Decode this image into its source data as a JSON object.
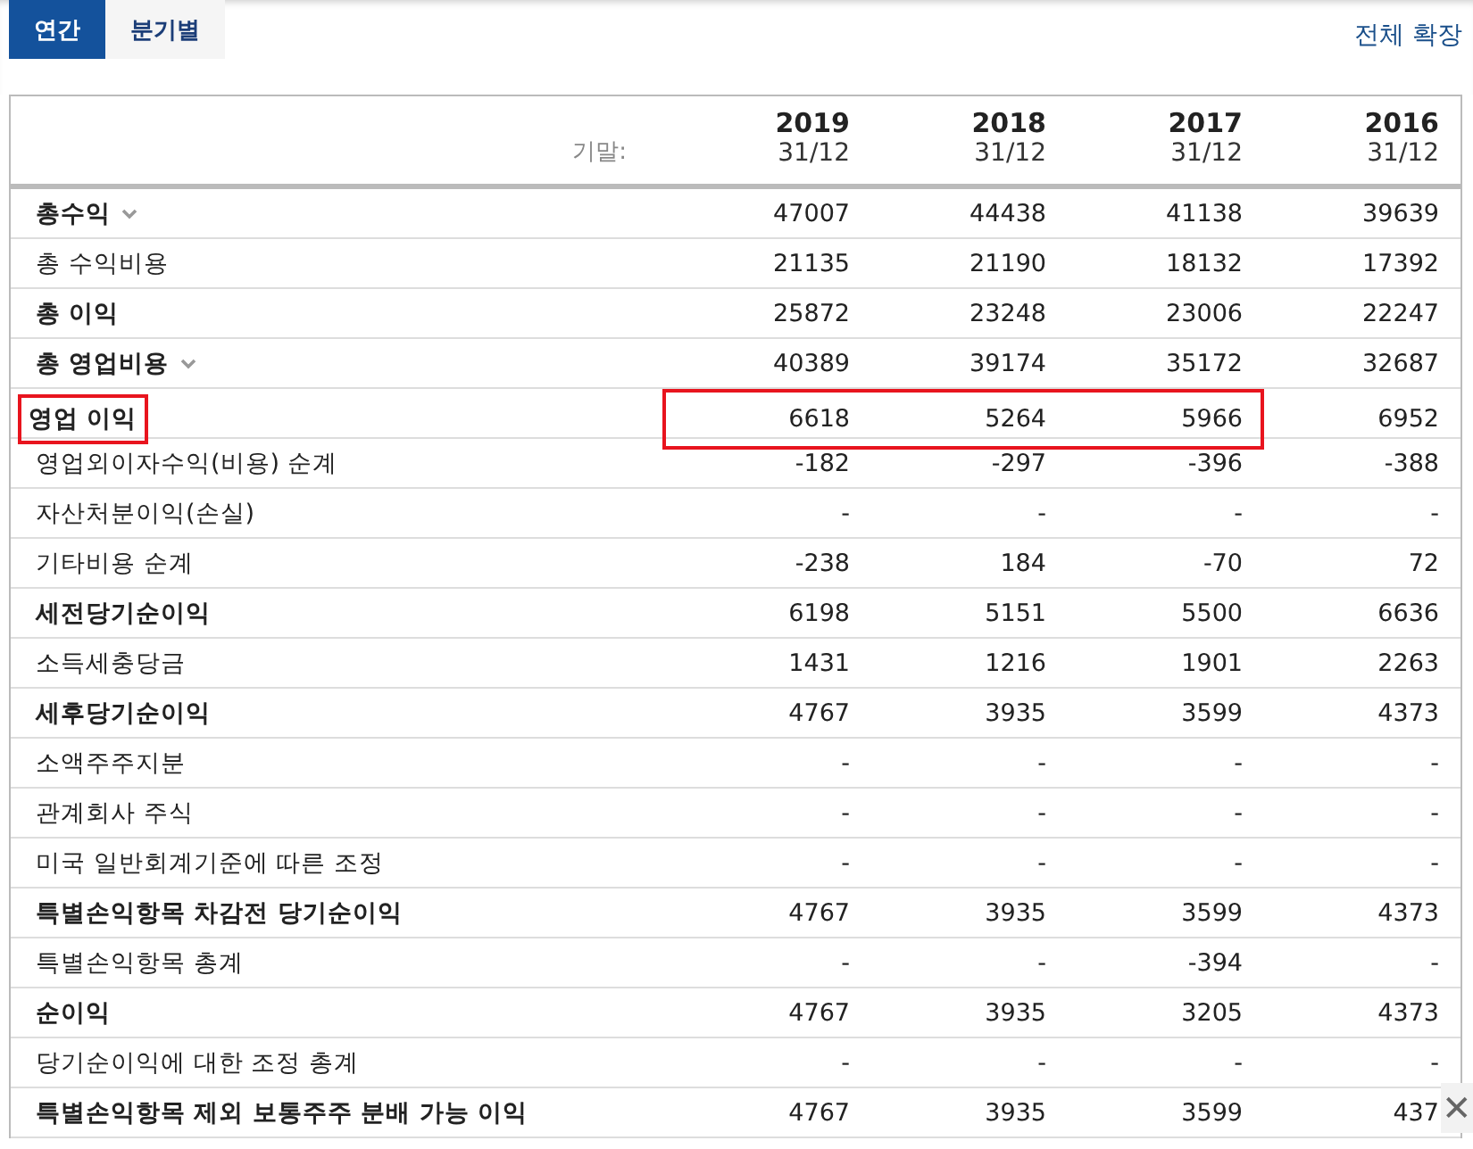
{
  "tabs": [
    {
      "label": "연간",
      "selected": true
    },
    {
      "label": "분기별",
      "selected": false
    }
  ],
  "expand_all_link": "전체 확장",
  "table": {
    "period_label": "기말:",
    "columns": [
      {
        "year": "2019",
        "date": "31/12"
      },
      {
        "year": "2018",
        "date": "31/12"
      },
      {
        "year": "2017",
        "date": "31/12"
      },
      {
        "year": "2016",
        "date": "31/12"
      }
    ],
    "rows": [
      {
        "label": "총수익",
        "bold": true,
        "expandable": true,
        "values": [
          "47007",
          "44438",
          "41138",
          "39639"
        ]
      },
      {
        "label": "총 수익비용",
        "bold": false,
        "expandable": false,
        "values": [
          "21135",
          "21190",
          "18132",
          "17392"
        ]
      },
      {
        "label": "총 이익",
        "bold": true,
        "expandable": false,
        "values": [
          "25872",
          "23248",
          "23006",
          "22247"
        ]
      },
      {
        "label": "총 영업비용",
        "bold": true,
        "expandable": true,
        "values": [
          "40389",
          "39174",
          "35172",
          "32687"
        ]
      },
      {
        "label": "영업 이익",
        "bold": true,
        "expandable": false,
        "values": [
          "6618",
          "5264",
          "5966",
          "6952"
        ],
        "highlight": {
          "label": true,
          "values": [
            true,
            true,
            true,
            false
          ]
        }
      },
      {
        "label": "영업외이자수익(비용) 순계",
        "bold": false,
        "expandable": false,
        "values": [
          "-182",
          "-297",
          "-396",
          "-388"
        ]
      },
      {
        "label": "자산처분이익(손실)",
        "bold": false,
        "expandable": false,
        "values": [
          "-",
          "-",
          "-",
          "-"
        ]
      },
      {
        "label": "기타비용 순계",
        "bold": false,
        "expandable": false,
        "values": [
          "-238",
          "184",
          "-70",
          "72"
        ]
      },
      {
        "label": "세전당기순이익",
        "bold": true,
        "expandable": false,
        "values": [
          "6198",
          "5151",
          "5500",
          "6636"
        ]
      },
      {
        "label": "소득세충당금",
        "bold": false,
        "expandable": false,
        "values": [
          "1431",
          "1216",
          "1901",
          "2263"
        ]
      },
      {
        "label": "세후당기순이익",
        "bold": true,
        "expandable": false,
        "values": [
          "4767",
          "3935",
          "3599",
          "4373"
        ]
      },
      {
        "label": "소액주주지분",
        "bold": false,
        "expandable": false,
        "values": [
          "-",
          "-",
          "-",
          "-"
        ]
      },
      {
        "label": "관계회사 주식",
        "bold": false,
        "expandable": false,
        "values": [
          "-",
          "-",
          "-",
          "-"
        ]
      },
      {
        "label": "미국 일반회계기준에 따른 조정",
        "bold": false,
        "expandable": false,
        "values": [
          "-",
          "-",
          "-",
          "-"
        ]
      },
      {
        "label": "특별손익항목 차감전 당기순이익",
        "bold": true,
        "expandable": false,
        "values": [
          "4767",
          "3935",
          "3599",
          "4373"
        ]
      },
      {
        "label": "특별손익항목 총계",
        "bold": false,
        "expandable": false,
        "values": [
          "-",
          "-",
          "-394",
          "-"
        ]
      },
      {
        "label": "순이익",
        "bold": true,
        "expandable": false,
        "values": [
          "4767",
          "3935",
          "3205",
          "4373"
        ]
      },
      {
        "label": "당기순이익에 대한 조정 총계",
        "bold": false,
        "expandable": false,
        "values": [
          "-",
          "-",
          "-",
          "-"
        ]
      },
      {
        "label": "특별손익항목 제외 보통주주 분배 가능 이익",
        "bold": true,
        "expandable": false,
        "values": [
          "4767",
          "3935",
          "3599",
          "437"
        ]
      }
    ]
  },
  "close_button": {
    "label": "✕"
  }
}
